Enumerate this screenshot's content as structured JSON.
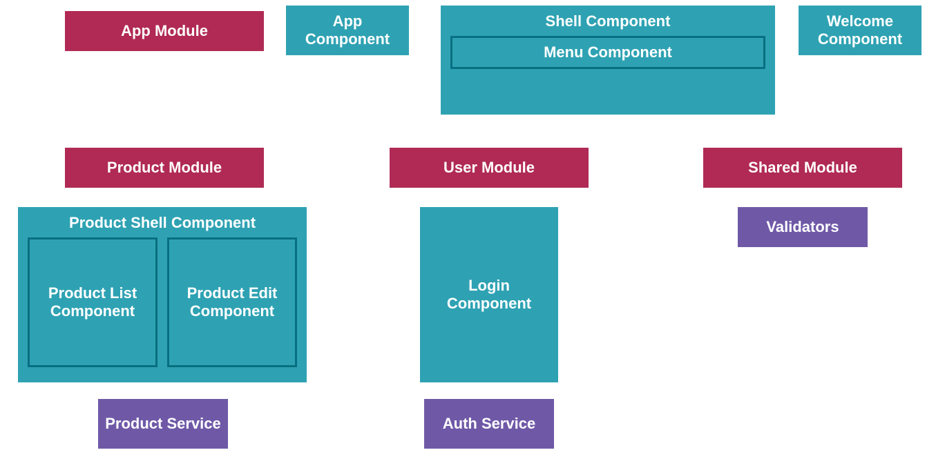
{
  "colors": {
    "module": "#b02a55",
    "component": "#2ea2b3",
    "service": "#6f59a7",
    "innerBorder": "#086f80"
  },
  "row1": {
    "appModule": "App Module",
    "appComponent": "App Component",
    "shellComponent": {
      "title": "Shell Component",
      "menu": "Menu Component"
    },
    "welcomeComponent": "Welcome Component"
  },
  "row2": {
    "productModule": "Product Module",
    "userModule": "User Module",
    "sharedModule": "Shared Module"
  },
  "row3": {
    "productShell": {
      "title": "Product Shell Component",
      "list": "Product List Component",
      "edit": "Product Edit Component"
    },
    "loginComponent": "Login Component",
    "validators": "Validators"
  },
  "row4": {
    "productService": "Product Service",
    "authService": "Auth Service"
  }
}
